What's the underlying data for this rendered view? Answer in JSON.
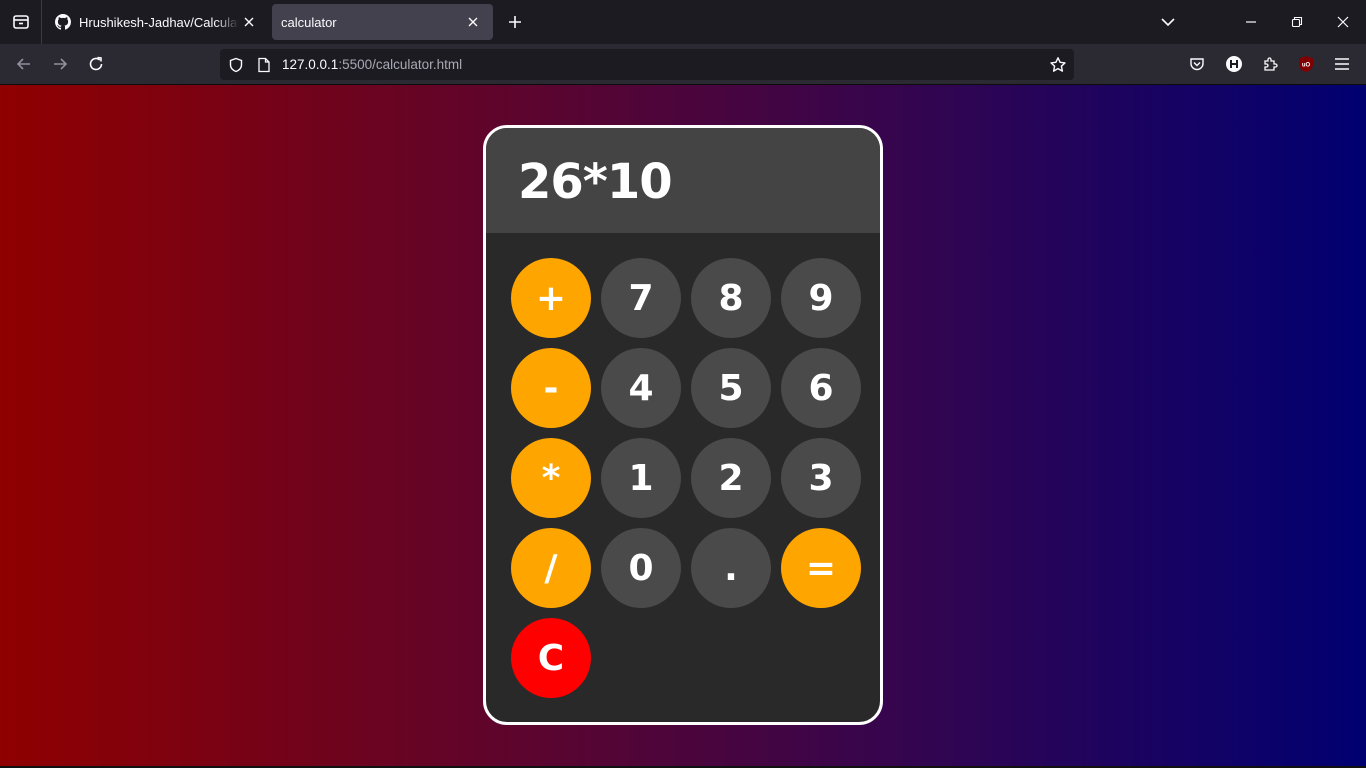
{
  "browser": {
    "tabs": [
      {
        "title": "Hrushikesh-Jadhav/Calculator",
        "active": false,
        "icon": "github-icon"
      },
      {
        "title": "calculator",
        "active": true,
        "icon": ""
      }
    ],
    "url": {
      "host": "127.0.0.1",
      "path": ":5500/calculator.html"
    },
    "toolbar_icons": [
      "pocket-icon",
      "extension-h-icon",
      "extensions-icon",
      "ublock-origin-icon",
      "menu-icon"
    ]
  },
  "colors": {
    "operator": "#ffa500",
    "number": "#4a4a4a",
    "clear": "#ff0000",
    "display_bg": "#444444",
    "body_bg": "#292929",
    "gradient_left": "#8f0000",
    "gradient_right": "#000071"
  },
  "calculator": {
    "display": "26*10",
    "keys": {
      "plus": "+",
      "seven": "7",
      "eight": "8",
      "nine": "9",
      "minus": "-",
      "four": "4",
      "five": "5",
      "six": "6",
      "multiply": "*",
      "one": "1",
      "two": "2",
      "three": "3",
      "divide": "/",
      "zero": "0",
      "decimal": ".",
      "equals": "=",
      "clear": "C"
    }
  }
}
